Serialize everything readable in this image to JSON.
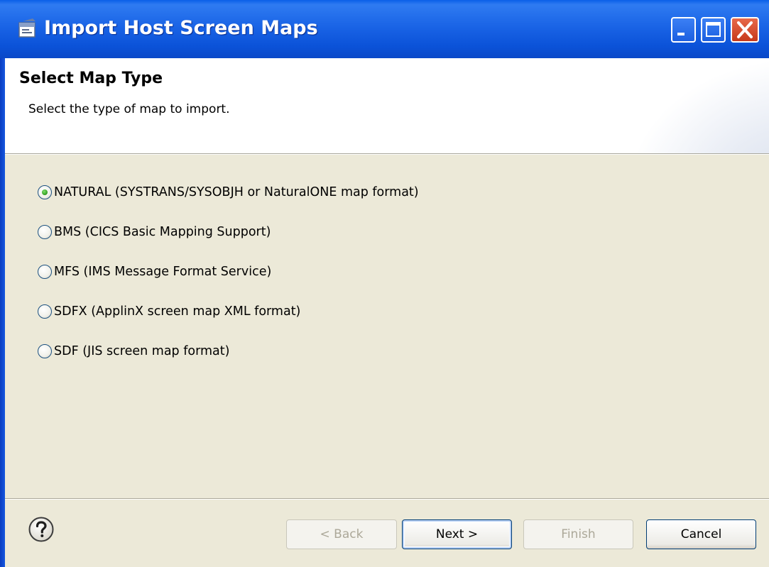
{
  "window": {
    "title": "Import Host Screen Maps"
  },
  "header": {
    "title": "Select Map Type",
    "description": "Select the type of map to import."
  },
  "options": [
    {
      "label": "NATURAL (SYSTRANS/SYSOBJH or NaturalONE map format)",
      "checked": true
    },
    {
      "label": "BMS (CICS Basic Mapping Support)",
      "checked": false
    },
    {
      "label": "MFS (IMS Message Format Service)",
      "checked": false
    },
    {
      "label": "SDFX (ApplinX screen map XML format)",
      "checked": false
    },
    {
      "label": "SDF (JIS screen map format)",
      "checked": false
    }
  ],
  "buttons": {
    "back": "< Back",
    "next": "Next >",
    "finish": "Finish",
    "cancel": "Cancel"
  },
  "icons": {
    "window": "wizard-window-icon",
    "help": "help-icon",
    "minimize": "minimize-icon",
    "maximize": "maximize-icon",
    "close": "close-icon"
  },
  "colors": {
    "titlebar": "#0a5fe8",
    "body": "#ece9d8",
    "radio_selected": "#3aa528"
  }
}
